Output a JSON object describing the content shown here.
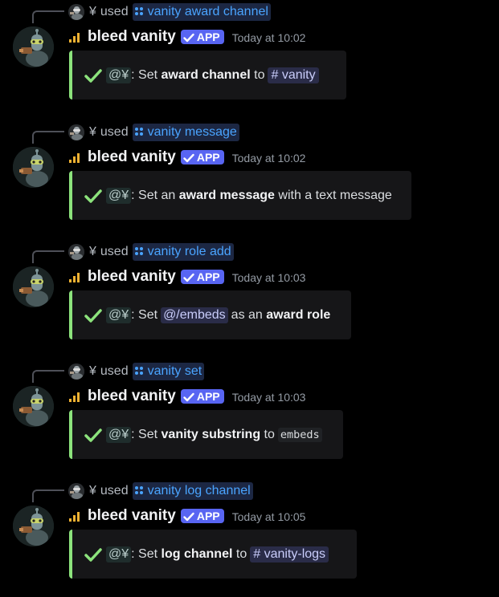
{
  "accent": {
    "app_badge": "#5865f2",
    "embed_border": "#8ce37c",
    "command_link": "#4aa4ff"
  },
  "messages": [
    {
      "reply_user": "¥",
      "reply_used": "used",
      "command": "vanity award channel",
      "author": "bleed vanity",
      "badge": "APP",
      "timestamp": "Today at 10:02",
      "embed": {
        "mention": "@¥",
        "colon": ":",
        "parts": [
          {
            "t": "Set ",
            "k": "text"
          },
          {
            "t": "award channel",
            "k": "bold"
          },
          {
            "t": " to",
            "k": "text"
          },
          {
            "t": "# vanity",
            "k": "channel"
          }
        ]
      }
    },
    {
      "reply_user": "¥",
      "reply_used": "used",
      "command": "vanity message",
      "author": "bleed vanity",
      "badge": "APP",
      "timestamp": "Today at 10:02",
      "embed": {
        "mention": "@¥",
        "colon": ":",
        "parts": [
          {
            "t": "Set an ",
            "k": "text"
          },
          {
            "t": "award message",
            "k": "bold"
          },
          {
            "t": " with a text message",
            "k": "text"
          }
        ]
      }
    },
    {
      "reply_user": "¥",
      "reply_used": "used",
      "command": "vanity role add",
      "author": "bleed vanity",
      "badge": "APP",
      "timestamp": "Today at 10:03",
      "embed": {
        "mention": "@¥",
        "colon": ":",
        "parts": [
          {
            "t": "Set",
            "k": "text"
          },
          {
            "t": "@/embeds",
            "k": "role"
          },
          {
            "t": "as an ",
            "k": "text"
          },
          {
            "t": "award role",
            "k": "bold"
          }
        ]
      }
    },
    {
      "reply_user": "¥",
      "reply_used": "used",
      "command": "vanity set",
      "author": "bleed vanity",
      "badge": "APP",
      "timestamp": "Today at 10:03",
      "embed": {
        "mention": "@¥",
        "colon": ":",
        "parts": [
          {
            "t": "Set ",
            "k": "text"
          },
          {
            "t": "vanity substring",
            "k": "bold"
          },
          {
            "t": " to",
            "k": "text"
          },
          {
            "t": "embeds",
            "k": "code"
          }
        ]
      }
    },
    {
      "reply_user": "¥",
      "reply_used": "used",
      "command": "vanity log channel",
      "author": "bleed vanity",
      "badge": "APP",
      "timestamp": "Today at 10:05",
      "embed": {
        "mention": "@¥",
        "colon": ":",
        "parts": [
          {
            "t": "Set ",
            "k": "text"
          },
          {
            "t": "log channel",
            "k": "bold"
          },
          {
            "t": " to",
            "k": "text"
          },
          {
            "t": "# vanity-logs",
            "k": "channel"
          }
        ]
      }
    }
  ]
}
